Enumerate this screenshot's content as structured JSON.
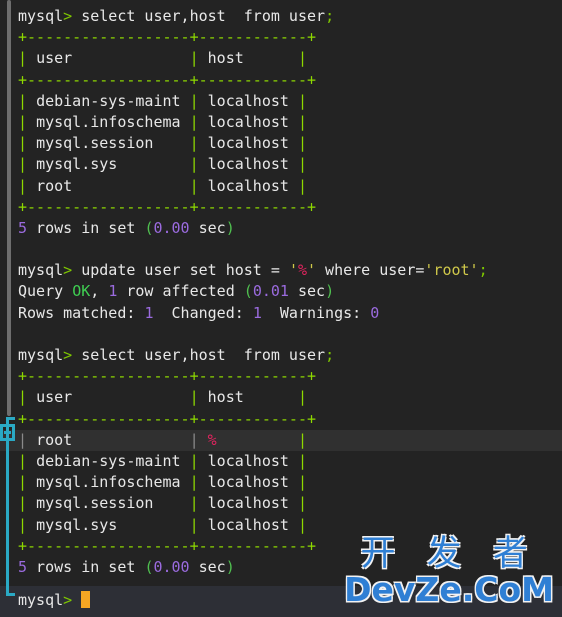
{
  "terminal": {
    "prompt": "mysql",
    "prompt_sym": ">",
    "cursor_color": "#f5a623",
    "bg_color": "#232323",
    "fg_color": "#e8e8e8",
    "border_color": "#8ed900",
    "number_color": "#9b6bdf",
    "string_color": "#cfc84a",
    "percent_color": "#e0245e"
  },
  "gutter": {
    "scrollbar_color": "#6e6e6e",
    "fold_marker_color": "#2aa9c4"
  },
  "lines": [
    {
      "id": "cmd-1-prompt",
      "type": "command",
      "prompt": "mysql",
      "sym": ">",
      "query": " select user,host  from user",
      "terminator": ";"
    },
    {
      "id": "t1-top",
      "type": "border",
      "text": "+------------------+------------+"
    },
    {
      "id": "t1-header",
      "type": "row",
      "c1": "user",
      "c2": "host"
    },
    {
      "id": "t1-sep",
      "type": "border",
      "text": "+------------------+------------+"
    },
    {
      "id": "t1-r1",
      "type": "row",
      "c1": "debian-sys-maint",
      "c2": "localhost"
    },
    {
      "id": "t1-r2",
      "type": "row",
      "c1": "mysql.infoschema",
      "c2": "localhost"
    },
    {
      "id": "t1-r3",
      "type": "row",
      "c1": "mysql.session",
      "c2": "localhost"
    },
    {
      "id": "t1-r4",
      "type": "row",
      "c1": "mysql.sys",
      "c2": "localhost"
    },
    {
      "id": "t1-r5",
      "type": "row",
      "c1": "root",
      "c2": "localhost"
    },
    {
      "id": "t1-bot",
      "type": "border",
      "text": "+------------------+------------+"
    },
    {
      "id": "t1-status",
      "type": "status",
      "count": "5",
      "mid": " rows in set ",
      "time": "0.00",
      "unit": " sec"
    }
  ],
  "update_block": {
    "prompt": "mysql",
    "sym": ">",
    "pre": " update user set host = ",
    "value_quote_open": "'",
    "value": "%",
    "value_quote_close": "'",
    "mid": " where user=",
    "user_literal": "'root'",
    "terminator": ";",
    "result_label": "Query ",
    "result_ok": "OK",
    "result_comma": ", ",
    "rows_affected": "1",
    "rows_affected_text": " row affected ",
    "time": "0.01",
    "time_unit": " sec",
    "matched_label": "Rows matched: ",
    "matched_value": "1",
    "changed_label": "  Changed: ",
    "changed_value": "1",
    "warnings_label": "  Warnings: ",
    "warnings_value": "0"
  },
  "lines2": [
    {
      "id": "cmd-2-prompt",
      "type": "command",
      "prompt": "mysql",
      "sym": ">",
      "query": " select user,host  from user",
      "terminator": ";"
    },
    {
      "id": "t2-top",
      "type": "border",
      "text": "+------------------+------------+"
    },
    {
      "id": "t2-header",
      "type": "row",
      "c1": "user",
      "c2": "host"
    },
    {
      "id": "t2-sep",
      "type": "border",
      "text": "+------------------+------------+"
    },
    {
      "id": "t2-r1",
      "type": "row-highlight",
      "c1": "root",
      "c2": "%"
    },
    {
      "id": "t2-r2",
      "type": "row",
      "c1": "debian-sys-maint",
      "c2": "localhost"
    },
    {
      "id": "t2-r3",
      "type": "row",
      "c1": "mysql.infoschema",
      "c2": "localhost"
    },
    {
      "id": "t2-r4",
      "type": "row",
      "c1": "mysql.session",
      "c2": "localhost"
    },
    {
      "id": "t2-r5",
      "type": "row",
      "c1": "mysql.sys",
      "c2": "localhost"
    },
    {
      "id": "t2-bot",
      "type": "border",
      "text": "+------------------+------------+"
    },
    {
      "id": "t2-status",
      "type": "status",
      "count": "5",
      "mid": " rows in set ",
      "time": "0.00",
      "unit": " sec"
    }
  ],
  "statusbar": {
    "prompt": "mysql",
    "sym": ">"
  },
  "watermark": {
    "cn": "开 发 者",
    "en": "DevZe.CoM",
    "color": "#2f7fd4"
  }
}
